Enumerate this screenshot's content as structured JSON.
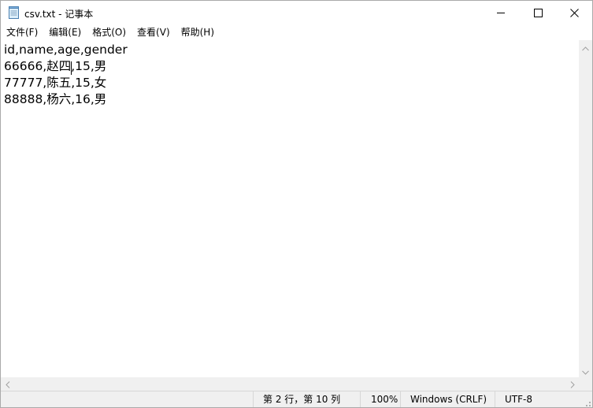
{
  "window": {
    "title": "csv.txt - 记事本",
    "app_icon": "notepad-icon",
    "controls": {
      "minimize_icon": "minimize-icon",
      "maximize_icon": "maximize-icon",
      "close_icon": "close-icon"
    }
  },
  "menubar": {
    "items": [
      {
        "label": "文件(F)"
      },
      {
        "label": "编辑(E)"
      },
      {
        "label": "格式(O)"
      },
      {
        "label": "查看(V)"
      },
      {
        "label": "帮助(H)"
      }
    ]
  },
  "editor": {
    "lines": [
      "id,name,age,gender",
      "66666,赵四,15,男",
      "77777,陈五,15,女",
      "88888,杨六,16,男"
    ]
  },
  "statusbar": {
    "position": "第 2 行，第 10 列",
    "zoom": "100%",
    "line_ending": "Windows (CRLF)",
    "encoding": "UTF-8"
  }
}
